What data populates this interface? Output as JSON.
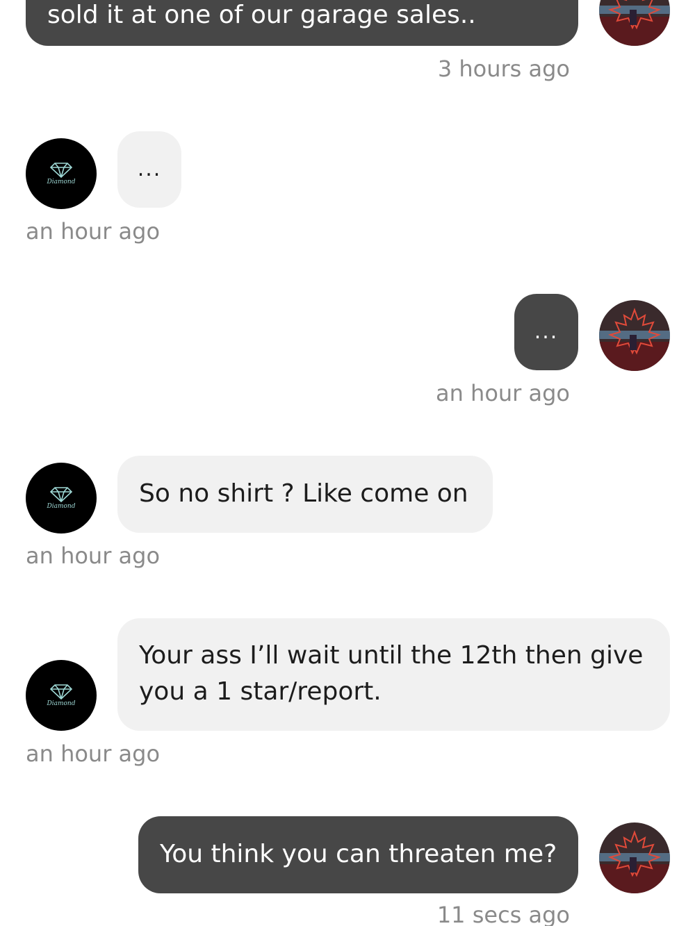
{
  "colors": {
    "outgoing_bubble": "#474747",
    "incoming_bubble": "#f1f1f1",
    "timestamp": "#8a8a8a"
  },
  "other_user": {
    "avatar_text": "Diamond",
    "avatar_icon": "diamond-logo-icon"
  },
  "me": {
    "avatar_icon": "maple-leaf-photo-avatar"
  },
  "messages": [
    {
      "direction": "outgoing",
      "text": "sold it at one of our garage sales..",
      "time": "3 hours ago"
    },
    {
      "direction": "incoming",
      "text": "...",
      "time": "an hour ago"
    },
    {
      "direction": "outgoing",
      "text": "...",
      "time": "an hour ago"
    },
    {
      "direction": "incoming",
      "text": "So no shirt ? Like come on",
      "time": "an hour ago"
    },
    {
      "direction": "incoming",
      "text": "Your ass I’ll wait until the 12th then give you a 1 star/report.",
      "time": "an hour ago"
    },
    {
      "direction": "outgoing",
      "text": "You think you can threaten me?",
      "time": "11 secs ago"
    }
  ]
}
